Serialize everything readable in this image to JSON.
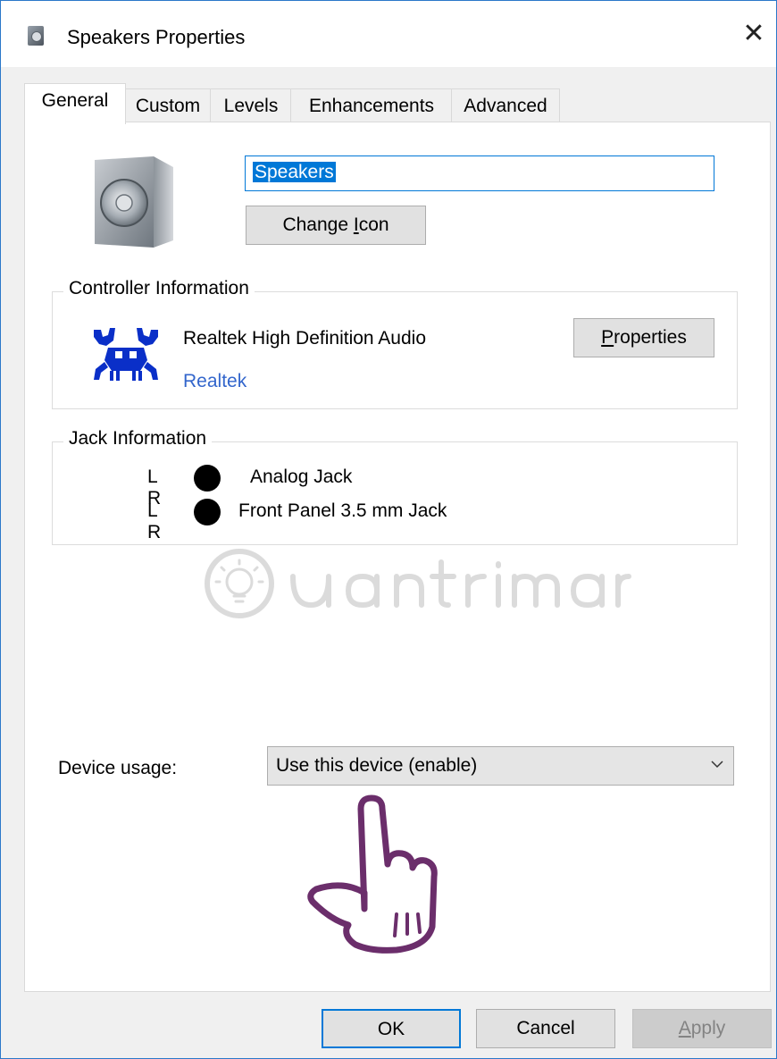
{
  "window": {
    "title": "Speakers Properties",
    "close_glyph": "✕"
  },
  "tabs": [
    {
      "label": "General",
      "active": true
    },
    {
      "label": "Custom",
      "active": false
    },
    {
      "label": "Levels",
      "active": false
    },
    {
      "label": "Enhancements",
      "active": false
    },
    {
      "label": "Advanced",
      "active": false
    }
  ],
  "general": {
    "device_name": "Speakers",
    "change_icon_label_pre": "Change ",
    "change_icon_label_underline": "I",
    "change_icon_label_post": "con"
  },
  "controller": {
    "group_title": "Controller Information",
    "name": "Realtek High Definition Audio",
    "vendor": "Realtek",
    "properties_label_underline": "P",
    "properties_label_post": "roperties"
  },
  "jack": {
    "group_title": "Jack Information",
    "rows": [
      {
        "channels": "L R",
        "label": "Analog Jack"
      },
      {
        "channels": "L R",
        "label": "Front Panel 3.5 mm Jack"
      }
    ]
  },
  "usage": {
    "label": "Device usage:",
    "selected": "Use this device (enable)"
  },
  "buttons": {
    "ok": "OK",
    "cancel": "Cancel",
    "apply_underline": "A",
    "apply_post": "pply"
  },
  "colors": {
    "accent": "#0078d7",
    "link": "#3366cc",
    "window_border": "#2b78c9"
  },
  "icons": {
    "title": "speaker-icon",
    "close": "close-icon",
    "device": "speaker-icon",
    "controller": "realtek-crab-icon",
    "jack": "jack-dot-icon",
    "dropdown": "chevron-down-icon",
    "pointer": "pointing-hand-icon"
  }
}
